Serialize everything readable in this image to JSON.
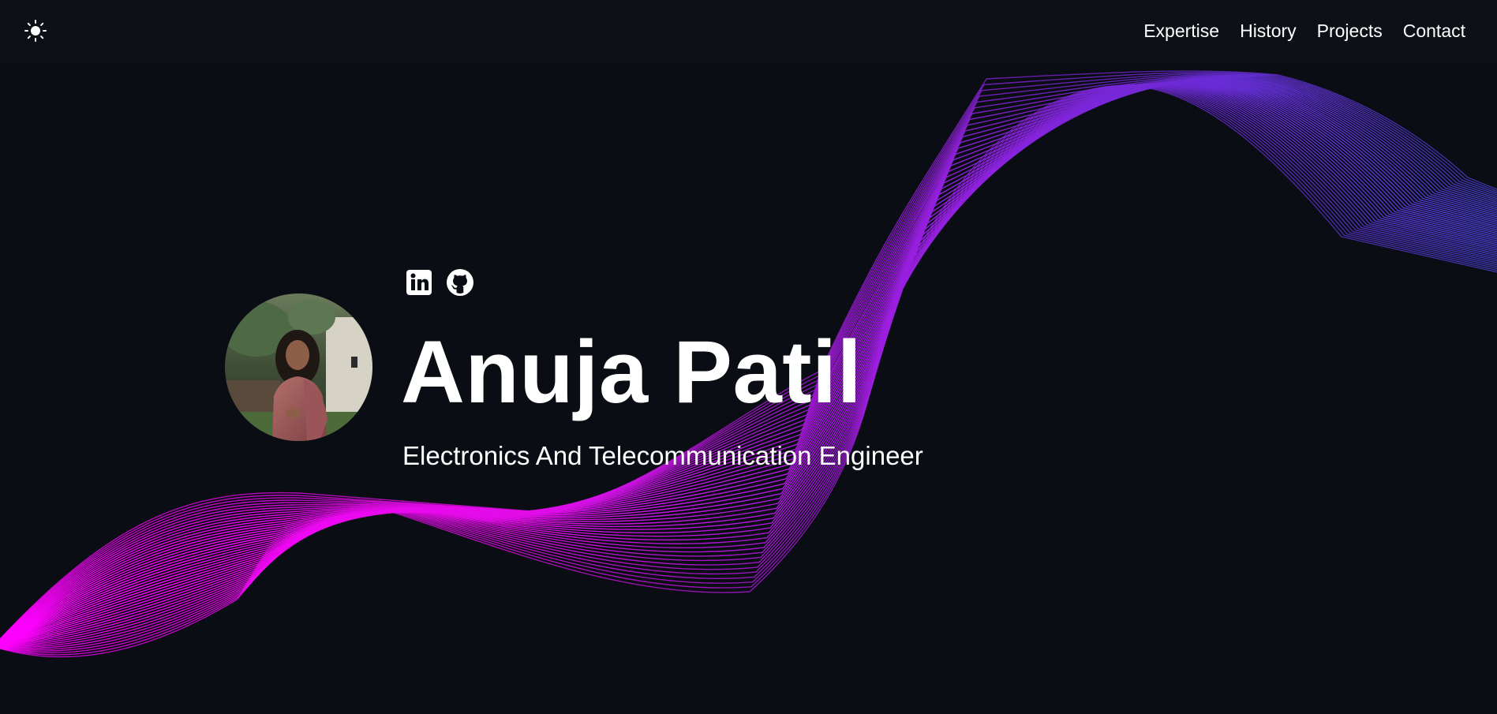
{
  "nav": {
    "theme_icon": "sun-icon",
    "links": [
      {
        "label": "Expertise"
      },
      {
        "label": "History"
      },
      {
        "label": "Projects"
      },
      {
        "label": "Contact"
      }
    ]
  },
  "hero": {
    "name": "Anuja Patil",
    "role": "Electronics And Telecommunication Engineer",
    "avatar_alt": "profile photo",
    "socials": [
      {
        "icon": "linkedin-icon"
      },
      {
        "icon": "github-icon"
      }
    ]
  },
  "colors": {
    "background": "#0a0d13",
    "navbar": "#0d1117",
    "wave_start": "#ff00ff",
    "wave_mid": "#9a1ee0",
    "wave_end": "#4a3fcf",
    "text": "#ffffff"
  }
}
